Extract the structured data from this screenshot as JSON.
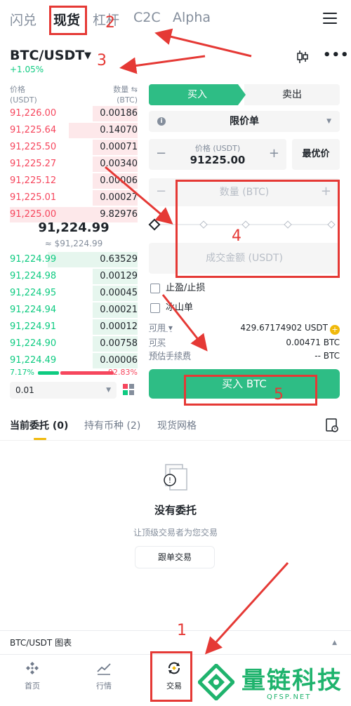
{
  "topnav": {
    "tabs": [
      "闪兑",
      "现货",
      "杠杆",
      "C2C",
      "Alpha"
    ],
    "active": "现货"
  },
  "pair": {
    "name": "BTC/USDT",
    "change": "+1.05%"
  },
  "orderbook": {
    "price_header": "价格",
    "price_unit": "(USDT)",
    "qty_header": "数量 ⇆",
    "qty_unit": "(BTC)",
    "asks": [
      {
        "price": "91,226.00",
        "qty": "0.00186"
      },
      {
        "price": "91,225.64",
        "qty": "0.14070"
      },
      {
        "price": "91,225.50",
        "qty": "0.00071"
      },
      {
        "price": "91,225.27",
        "qty": "0.00340"
      },
      {
        "price": "91,225.12",
        "qty": "0.00006"
      },
      {
        "price": "91,225.01",
        "qty": "0.00027"
      },
      {
        "price": "91,225.00",
        "qty": "9.82976"
      }
    ],
    "last_price": "91,224.99",
    "last_price_fiat": "≈ $91,224.99",
    "bids": [
      {
        "price": "91,224.99",
        "qty": "0.63529"
      },
      {
        "price": "91,224.98",
        "qty": "0.00129"
      },
      {
        "price": "91,224.95",
        "qty": "0.00045"
      },
      {
        "price": "91,224.94",
        "qty": "0.00021"
      },
      {
        "price": "91,224.91",
        "qty": "0.00012"
      },
      {
        "price": "91,224.90",
        "qty": "0.00758"
      },
      {
        "price": "91,224.49",
        "qty": "0.00006"
      }
    ],
    "buy_ratio": "7.17%",
    "sell_ratio": "92.83%",
    "buy_fraction": 0.0717,
    "depth": "0.01"
  },
  "form": {
    "buy_tab": "买入",
    "sell_tab": "卖出",
    "order_type": "限价单",
    "price_label": "价格 (USDT)",
    "price_value": "91225.00",
    "best_price": "最优价",
    "qty_placeholder": "数量 (BTC)",
    "amount_placeholder": "成交金额 (USDT)",
    "tp_sl": "止盈/止损",
    "iceberg": "冰山单",
    "available_label": "可用",
    "available_value": "429.67174902 USDT",
    "can_buy_label": "可买",
    "can_buy_value": "0.00471 BTC",
    "fee_label": "预估手续费",
    "fee_value": "-- BTC",
    "submit": "买入 BTC"
  },
  "orders": {
    "tabs": [
      "当前委托 (0)",
      "持有币种 (2)",
      "现货网格"
    ],
    "empty_title": "没有委托",
    "empty_sub": "让顶级交易者为您交易",
    "copy_button": "跟单交易"
  },
  "chart_bar": {
    "label": "BTC/USDT 图表"
  },
  "bottom_nav": [
    {
      "label": "首页",
      "icon": "home-icon"
    },
    {
      "label": "行情",
      "icon": "markets-icon"
    },
    {
      "label": "交易",
      "icon": "trade-icon"
    }
  ],
  "annotations": [
    "1",
    "2",
    "3",
    "4",
    "5"
  ],
  "watermark": {
    "name": "量链科技",
    "url": "QFSP.NET"
  },
  "colors": {
    "green": "#2ebd85",
    "red": "#f6465d",
    "accent": "#f0b90b",
    "annotation": "#e53935"
  }
}
